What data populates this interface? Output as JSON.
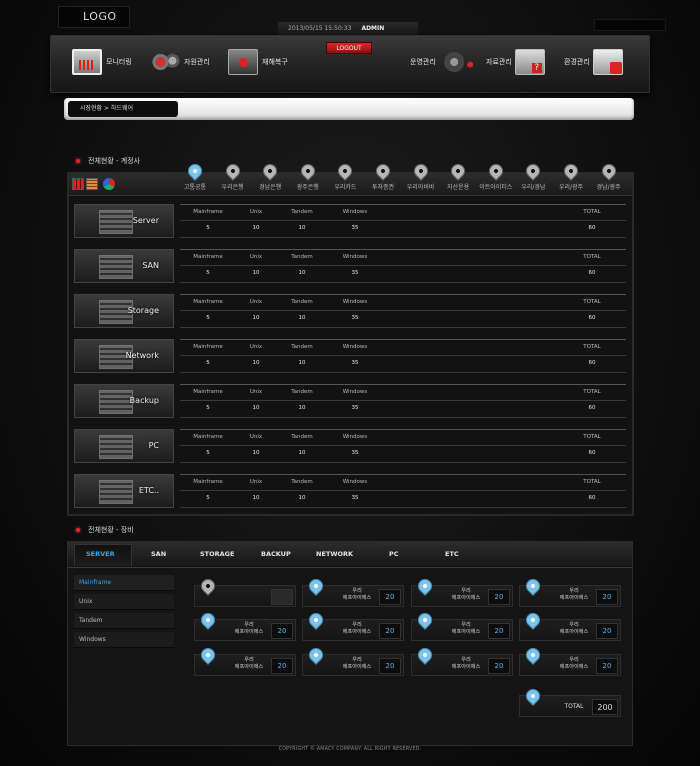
{
  "header": {
    "logo": "LOGO",
    "datetime": "2013/05/15 15:50:33",
    "user": "ADMIN",
    "logout": "LOGOUT"
  },
  "nav": {
    "items": [
      {
        "label": "모니터링",
        "icon": "monitor-icon"
      },
      {
        "label": "자원관리",
        "icon": "gears-icon"
      },
      {
        "label": "재해복구",
        "icon": "server-icon"
      },
      {
        "label": "운영관리",
        "icon": "ops-gears-icon"
      },
      {
        "label": "자료관리",
        "icon": "data-icon"
      },
      {
        "label": "환경관리",
        "icon": "environment-icon"
      }
    ]
  },
  "breadcrumb": "시장현황 > 하드웨어",
  "section1": {
    "title": "전체현황 - 계정사",
    "regions": [
      "고통공통",
      "우리은행",
      "경남은행",
      "광주은행",
      "우리카드",
      "투자증권",
      "우리아비바",
      "자산운용",
      "이트아이티스",
      "우리/경남",
      "우리/광주",
      "경남/광주"
    ],
    "active_region": 0,
    "columns": [
      "Mainframe",
      "Unix",
      "Tandem",
      "Windows",
      "TOTAL"
    ],
    "devices": [
      {
        "name": "Server",
        "values": [
          "5",
          "10",
          "10",
          "35",
          "60"
        ]
      },
      {
        "name": "SAN",
        "values": [
          "5",
          "10",
          "10",
          "35",
          "60"
        ]
      },
      {
        "name": "Storage",
        "values": [
          "5",
          "10",
          "10",
          "35",
          "60"
        ]
      },
      {
        "name": "Network",
        "values": [
          "5",
          "10",
          "10",
          "35",
          "60"
        ]
      },
      {
        "name": "Backup",
        "values": [
          "5",
          "10",
          "10",
          "35",
          "60"
        ]
      },
      {
        "name": "PC",
        "values": [
          "5",
          "10",
          "10",
          "35",
          "60"
        ]
      },
      {
        "name": "ETC..",
        "values": [
          "5",
          "10",
          "10",
          "35",
          "60"
        ]
      }
    ]
  },
  "section2": {
    "title": "전체현황 - 장비",
    "tabs": [
      "SERVER",
      "SAN",
      "STORAGE",
      "BACKUP",
      "NETWORK",
      "PC",
      "ETC"
    ],
    "active_tab": 0,
    "side": [
      "Mainframe",
      "Unix",
      "Tandem",
      "Windows"
    ],
    "active_side": 0,
    "cards": [
      [
        {
          "name": "",
          "value": ""
        },
        {
          "name": "우리\n에프아이에스",
          "value": "20"
        },
        {
          "name": "우리\n에프아이에스",
          "value": "20"
        },
        {
          "name": "우리\n에프아이에스",
          "value": "20"
        }
      ],
      [
        {
          "name": "우리\n에프아이에스",
          "value": "20"
        },
        {
          "name": "우리\n에프아이에스",
          "value": "20"
        },
        {
          "name": "우리\n에프아이에스",
          "value": "20"
        },
        {
          "name": "우리\n에프아이에스",
          "value": "20"
        }
      ],
      [
        {
          "name": "우리\n에프아이에스",
          "value": "20"
        },
        {
          "name": "우리\n에프아이에스",
          "value": "20"
        },
        {
          "name": "우리\n에프아이에스",
          "value": "20"
        },
        {
          "name": "우리\n에프아이에스",
          "value": "20"
        }
      ]
    ],
    "total_label": "TOTAL",
    "total_value": "200"
  },
  "footer": "COPYRIGHT © AMACY COMPANY. ALL RIGHT RESERVED."
}
